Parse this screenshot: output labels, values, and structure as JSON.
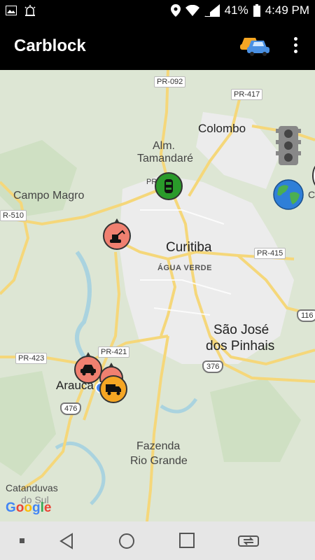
{
  "status": {
    "battery": "41%",
    "time": "4:49 PM"
  },
  "app": {
    "title": "Carblock"
  },
  "map": {
    "labels": {
      "colombo": "Colombo",
      "alm": "Alm.",
      "tamandare": "Tamandaré",
      "campo_magro": "Campo Magro",
      "curitiba": "Curitiba",
      "agua_verde": "ÁGUA VERDE",
      "sao_jose": "São José",
      "dos_pinhais": "dos Pinhais",
      "arauca": "Arauca",
      "fazenda": "Fazenda",
      "rio_grande": "Rio Grande",
      "catanduvas": "Catanduvas",
      "do_sul": "do Sul"
    },
    "roads": {
      "pr092": "PR-092",
      "pr417": "PR-417",
      "pr510": "R-510",
      "pr415": "PR-415",
      "pr421": "PR-421",
      "pr423": "PR-423",
      "pr": "PR",
      "br116": "116",
      "br376": "376",
      "br476": "476",
      "c": "C"
    },
    "google": "Google"
  },
  "colors": {
    "marker_red": "#f08070",
    "marker_green": "#2a9a2a",
    "marker_orange": "#f5a623",
    "road": "#f5d77a"
  }
}
